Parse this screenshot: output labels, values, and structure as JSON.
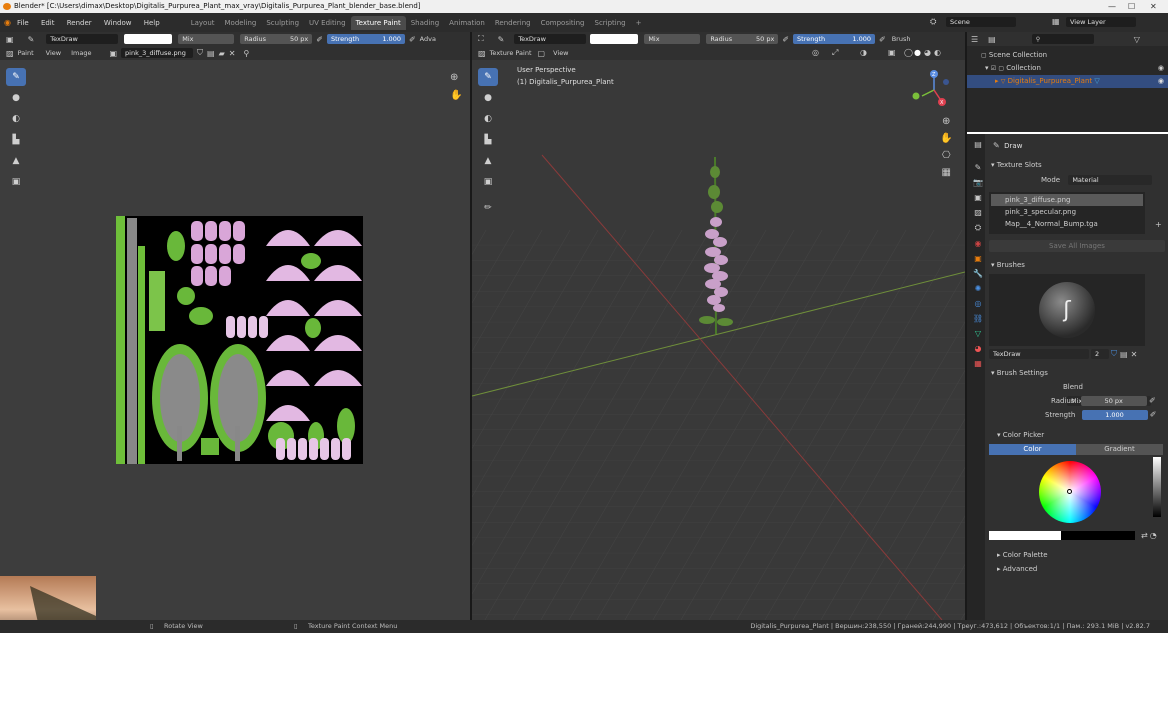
{
  "window": {
    "title": "Blender* [C:\\Users\\dimax\\Desktop\\Digitalis_Purpurea_Plant_max_vray\\Digitalis_Purpurea_Plant_blender_base.blend]",
    "minimize": "—",
    "maximize": "☐",
    "close": "✕"
  },
  "menu": [
    "File",
    "Edit",
    "Render",
    "Window",
    "Help"
  ],
  "workspaces": [
    "Layout",
    "Modeling",
    "Sculpting",
    "UV Editing",
    "Texture Paint",
    "Shading",
    "Animation",
    "Rendering",
    "Compositing",
    "Scripting"
  ],
  "workspace_add": "+",
  "scene": {
    "label": "Scene",
    "view_layer": "View Layer"
  },
  "image_editor": {
    "brush": "TexDraw",
    "blend": "Mix",
    "radius_label": "Radius",
    "radius_value": "50 px",
    "strength_label": "Strength",
    "strength_value": "1.000",
    "adv": "Adva",
    "mode": "Paint",
    "view": "View",
    "image": "Image",
    "image_name": "pink_3_diffuse.png"
  },
  "viewport": {
    "brush": "TexDraw",
    "blend": "Mix",
    "radius_label": "Radius",
    "radius_value": "50 px",
    "strength_label": "Strength",
    "strength_value": "1.000",
    "brush_menu": "Brush",
    "mode": "Texture Paint",
    "view": "View",
    "perspective": "User Perspective",
    "object": "(1) Digitalis_Purpurea_Plant",
    "gizmo": {
      "x": "X",
      "y": "Y",
      "z": "Z"
    }
  },
  "outliner": {
    "scene_collection": "Scene Collection",
    "collection": "Collection",
    "object": "Digitalis_Purpurea_Plant"
  },
  "properties": {
    "tool_name": "Draw",
    "texture_slots": {
      "title": "Texture Slots",
      "mode_label": "Mode",
      "mode_value": "Material",
      "slots": [
        "pink_3_diffuse.png",
        "pink_3_specular.png",
        "Map__4_Normal_Bump.tga"
      ],
      "save_all": "Save All Images"
    },
    "brushes": {
      "title": "Brushes",
      "brush_name": "TexDraw",
      "users": "2"
    },
    "brush_settings": {
      "title": "Brush Settings",
      "blend_label": "Blend",
      "blend_value": "Mix",
      "radius_label": "Radius",
      "radius_value": "50 px",
      "strength_label": "Strength",
      "strength_value": "1.000"
    },
    "color_picker": {
      "title": "Color Picker",
      "tab_color": "Color",
      "tab_gradient": "Gradient"
    },
    "color_palette": "Color Palette",
    "advanced": "Advanced"
  },
  "status": {
    "left": "Rotate View",
    "middle": "Texture Paint Context Menu",
    "right": "Digitalis_Purpurea_Plant | Вершин:238,550 | Граней:244,990 | Треуг.:473,612 | Объектов:1/1 | Пам.: 293.1 MiB | v2.82.7"
  },
  "colors": {
    "accent": "#4772b3",
    "orange": "#e87d0d",
    "panel": "#303030",
    "area": "#282828"
  }
}
